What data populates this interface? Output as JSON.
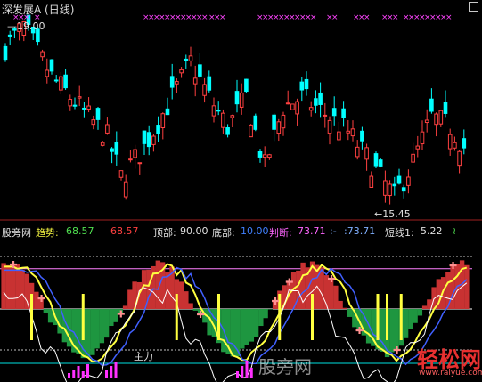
{
  "window": {
    "title": "深发展A (日线)",
    "corner_icon": "square-icon"
  },
  "main_chart": {
    "high_label": "19.00",
    "low_label": "←15.45",
    "colors": {
      "up": "#ff4040",
      "down": "#00ffff",
      "marker": "#ff44ff",
      "background": "#000000"
    }
  },
  "indicator_bar": {
    "source": "股旁网",
    "trend_label": "趋势:",
    "trend_value": "68.57",
    "trend_value2": "68.57",
    "top_label": "顶部:",
    "top_value": "90.00",
    "bottom_label": "底部:",
    "bottom_value": "10.00",
    "judge_label": "判断:",
    "judge_value": "73.71",
    "colon_label": ":-",
    "colon_value": ":73.71",
    "short_label": "短线1:",
    "short_value": "5.22"
  },
  "sub_chart": {
    "main_force_label": "主力",
    "colors": {
      "upper_fill": "#c83232",
      "lower_fill": "#1e9640",
      "trend_line": "#ffff40",
      "aux_line": "#4060ff",
      "stick": "#ffff40",
      "vol": "#ff30ff",
      "white_line": "#ffffff",
      "level_line": "#ff80ff"
    }
  },
  "watermarks": {
    "center_text": "股旁网",
    "logo_text": "轻松网",
    "url_text": "www.raiyue.com"
  },
  "chart_data": {
    "type": "candlestick",
    "title": "深发展A (日线)",
    "price_max": 19.0,
    "price_min": 15.45,
    "sub_indicators": {
      "趋势": 68.57,
      "顶部": 90.0,
      "底部": 10.0,
      "判断": 73.71,
      "短线1": 5.22
    },
    "top_level": 90,
    "bottom_level": 10
  }
}
